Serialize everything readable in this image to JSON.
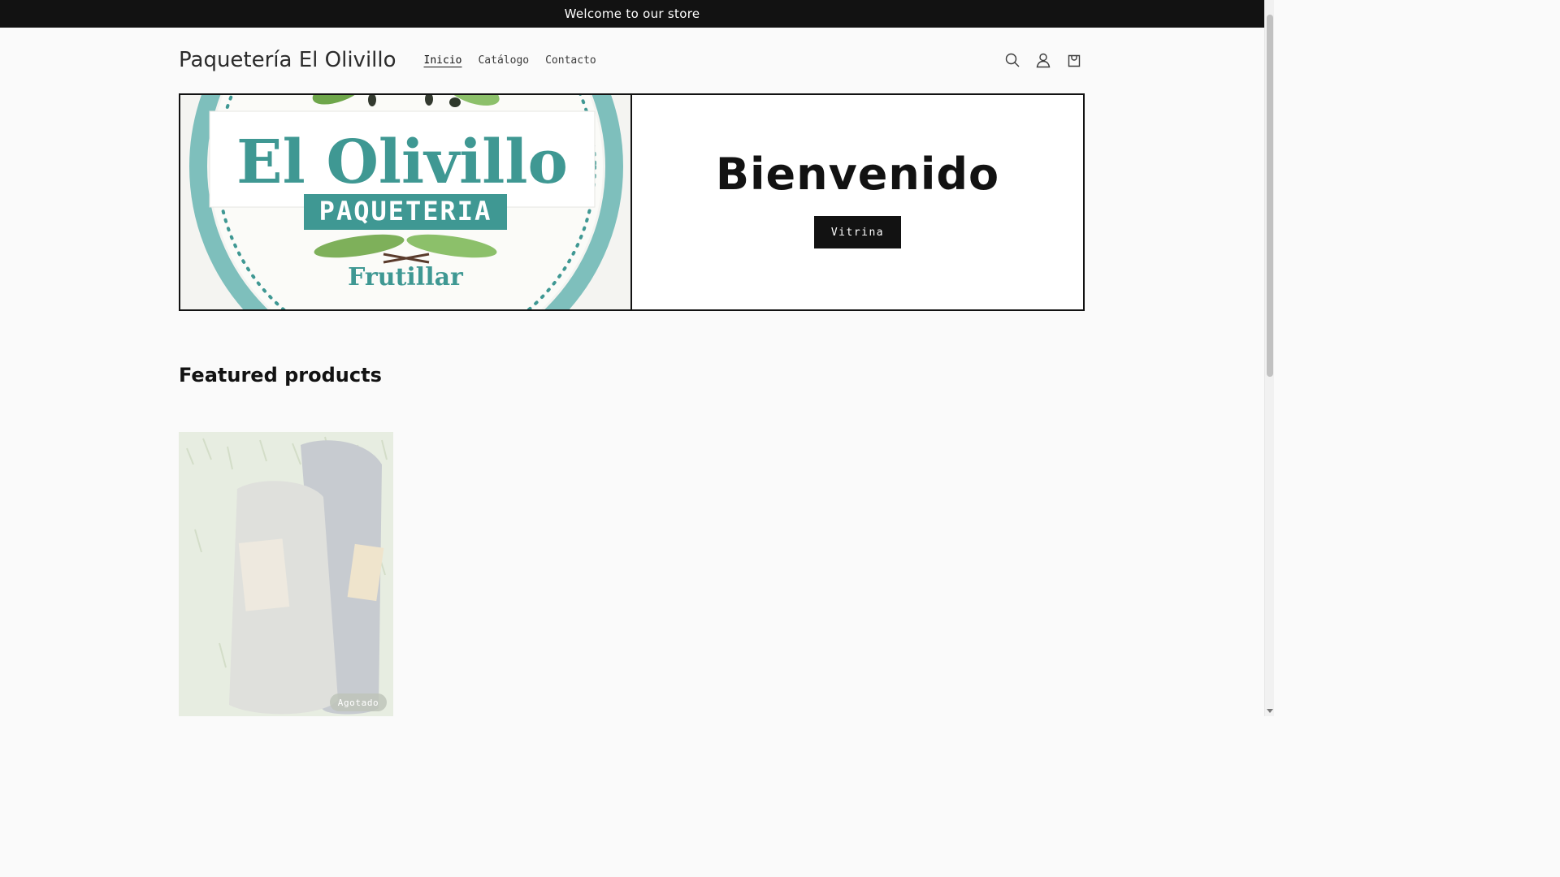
{
  "announcement": {
    "text": "Welcome to our store"
  },
  "header": {
    "store_name": "Paquetería El Olivillo",
    "nav": [
      {
        "label": "Inicio",
        "active": true
      },
      {
        "label": "Catálogo",
        "active": false
      },
      {
        "label": "Contacto",
        "active": false
      }
    ],
    "icons": [
      "search-icon",
      "account-icon",
      "cart-icon"
    ]
  },
  "hero": {
    "logo": {
      "line1": "El Olivillo",
      "line2": "PAQUETERIA",
      "line3": "Frutillar"
    },
    "title": "Bienvenido",
    "button_label": "Vitrina"
  },
  "featured": {
    "title": "Featured products",
    "products": [
      {
        "badge": "Agotado"
      }
    ]
  },
  "colors": {
    "text": "#121212",
    "background": "#fafafa",
    "teal": "#3f9893",
    "teal_light": "#7ebfbc",
    "leaf": "#6ea64a"
  }
}
